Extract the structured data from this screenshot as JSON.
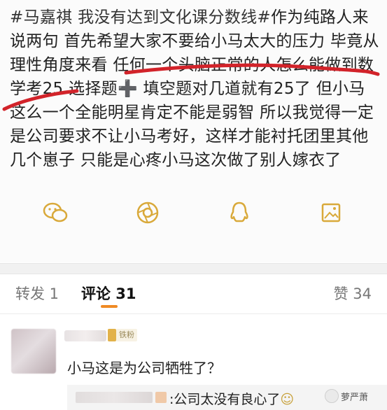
{
  "post": {
    "hashtag": "#马嘉祺 我没有达到文化课分数线#",
    "body": "作为纯路人来说两句 首先希望大家不要给小马太大的压力 毕竟从理性角度来看 任何一个头脑正常的人怎么能做到数学考25 选择题➕ 填空题对几道就有25了 但小马这么一个全能明星肯定不能是弱智 所以我觉得一定是公司要求不让小马考好，这样才能衬托团里其他几个崽子 只能是心疼小马这次做了别人嫁衣了"
  },
  "share_bar": {
    "icons": [
      "wechat-icon",
      "moments-icon",
      "qq-icon",
      "save-image-icon"
    ],
    "accent": "#d9a93a"
  },
  "tabs": {
    "repost": "转发 1",
    "comments": "评论 31",
    "likes": "赞 34",
    "active_color": "#f08a24"
  },
  "comment": {
    "badge": "铁粉",
    "text": "小马这是为公司牺牲了？",
    "reply": ":公司太没有良心了"
  },
  "watermark": {
    "text": "萝严萧"
  }
}
